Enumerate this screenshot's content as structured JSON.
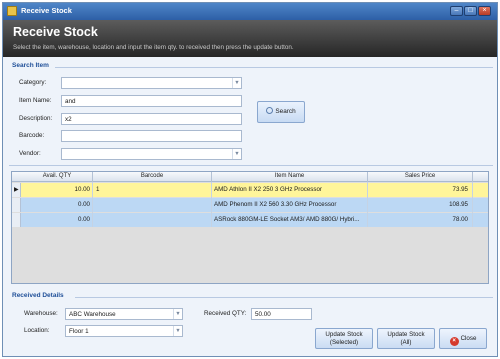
{
  "window": {
    "title": "Receive Stock"
  },
  "header": {
    "title": "Receive Stock",
    "subtitle": "Select the item, warehouse, location and input the item qty. to received then press the update button."
  },
  "search": {
    "section_label": "Search Item",
    "category_label": "Category:",
    "category_value": "",
    "item_name_label": "Item Name:",
    "item_name_value": "and",
    "description_label": "Description:",
    "description_value": "x2",
    "barcode_label": "Barcode:",
    "barcode_value": "",
    "vendor_label": "Vendor:",
    "vendor_value": "",
    "search_button": "Search"
  },
  "grid": {
    "columns": [
      "Avail. QTY",
      "Barcode",
      "Item Name",
      "Sales Price"
    ],
    "rows": [
      {
        "qty": "10.00",
        "barcode": "1",
        "name": "AMD Athlon II X2 250 3 GHz Processor",
        "price": "73.95",
        "style": "selected"
      },
      {
        "qty": "0.00",
        "barcode": "",
        "name": "AMD Phenom II X2 560 3.30 GHz Processor",
        "price": "108.95",
        "style": "normal"
      },
      {
        "qty": "0.00",
        "barcode": "",
        "name": "ASRock 880GM-LE Socket AM3/ AMD 880G/ Hybri...",
        "price": "78.00",
        "style": "normal"
      }
    ]
  },
  "received": {
    "section_label": "Received Details",
    "warehouse_label": "Warehouse:",
    "warehouse_value": "ABC Warehouse",
    "location_label": "Location:",
    "location_value": "Floor 1",
    "qty_label": "Received QTY:",
    "qty_value": "50.00"
  },
  "buttons": {
    "update_selected_line1": "Update Stock",
    "update_selected_line2": "(Selected)",
    "update_all_line1": "Update Stock",
    "update_all_line2": "(All)",
    "close": "Close"
  },
  "colors": {
    "selected_row": "#fff59a",
    "normal_row": "#bcd8f4",
    "header_bg": "#3b3b3b",
    "accent": "#1f4f98"
  }
}
